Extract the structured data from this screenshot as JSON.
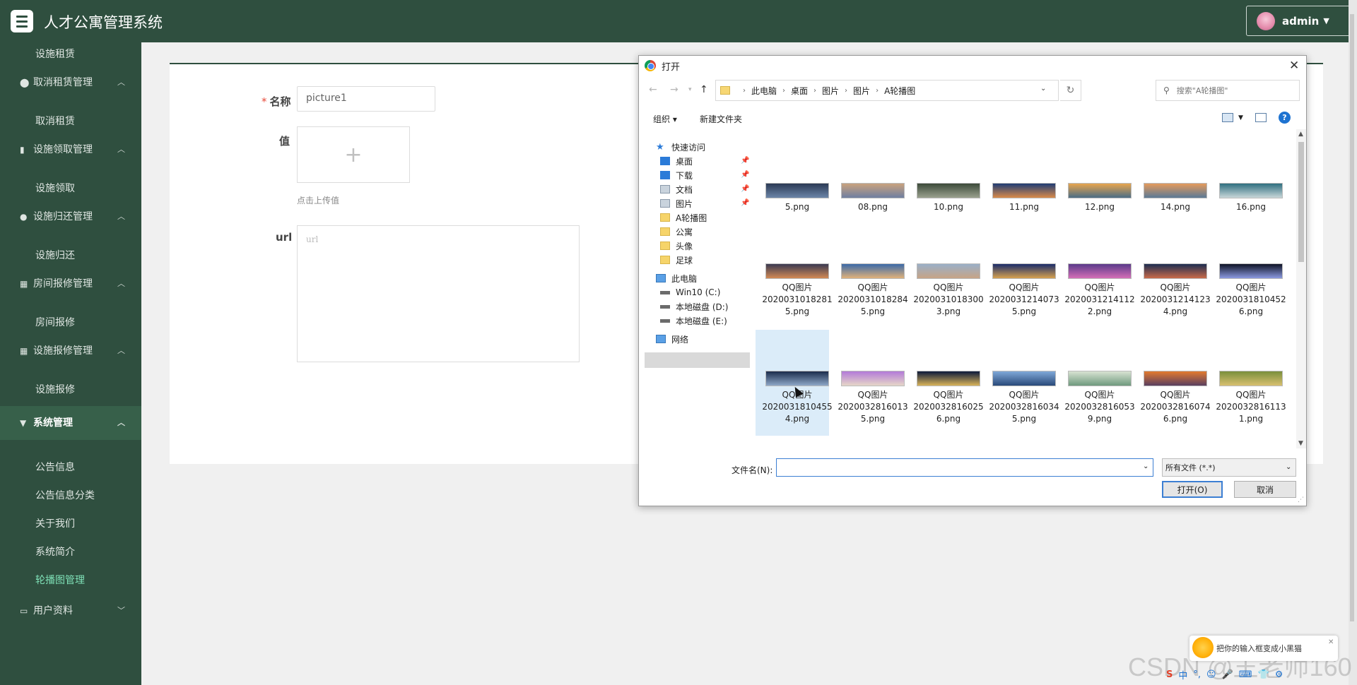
{
  "header": {
    "title": "人才公寓管理系统",
    "user": "admin"
  },
  "sidebar": {
    "items": [
      {
        "type": "sub",
        "label": "设施租赁"
      },
      {
        "type": "group",
        "label": "取消租赁管理",
        "icon": "location-pin-icon"
      },
      {
        "type": "sub",
        "label": "取消租赁"
      },
      {
        "type": "group",
        "label": "设施领取管理",
        "icon": "bar-chart-icon"
      },
      {
        "type": "sub",
        "label": "设施领取"
      },
      {
        "type": "group",
        "label": "设施归还管理",
        "icon": "user-icon"
      },
      {
        "type": "sub",
        "label": "设施归还"
      },
      {
        "type": "group",
        "label": "房间报修管理",
        "icon": "grid-icon"
      },
      {
        "type": "sub",
        "label": "房间报修"
      },
      {
        "type": "group",
        "label": "设施报修管理",
        "icon": "grid-icon"
      },
      {
        "type": "sub",
        "label": "设施报修"
      },
      {
        "type": "group",
        "label": "系统管理",
        "icon": "pin-icon",
        "active": true
      },
      {
        "type": "sub",
        "label": "公告信息"
      },
      {
        "type": "sub",
        "label": "公告信息分类"
      },
      {
        "type": "sub",
        "label": "关于我们"
      },
      {
        "type": "sub",
        "label": "系统简介"
      },
      {
        "type": "sub",
        "label": "轮播图管理",
        "highlight": true
      },
      {
        "type": "group",
        "label": "用户资料",
        "icon": "form-icon"
      }
    ]
  },
  "form": {
    "name_label": "名称",
    "name_value": "picture1",
    "value_label": "值",
    "upload_plus": "+",
    "upload_hint": "点击上传值",
    "url_label": "url",
    "url_placeholder": "url"
  },
  "dialog": {
    "title": "打开",
    "close": "✕",
    "path": [
      "此电脑",
      "桌面",
      "图片",
      "图片",
      "A轮播图"
    ],
    "search_placeholder": "搜索\"A轮播图\"",
    "organize": "组织 ▾",
    "new_folder": "新建文件夹",
    "tree": [
      {
        "label": "快速访问",
        "icon": "star-icon"
      },
      {
        "label": "桌面",
        "icon": "desktop-icon",
        "pinned": true
      },
      {
        "label": "下载",
        "icon": "download-icon",
        "pinned": true
      },
      {
        "label": "文档",
        "icon": "document-icon",
        "pinned": true
      },
      {
        "label": "图片",
        "icon": "pictures-icon",
        "pinned": true
      },
      {
        "label": "A轮播图",
        "icon": "folder-icon"
      },
      {
        "label": "公寓",
        "icon": "folder-icon"
      },
      {
        "label": "头像",
        "icon": "folder-icon"
      },
      {
        "label": "足球",
        "icon": "folder-icon"
      },
      {
        "label": "此电脑",
        "icon": "computer-icon",
        "selected": true
      },
      {
        "label": "Win10 (C:)",
        "icon": "drive-icon"
      },
      {
        "label": "本地磁盘 (D:)",
        "icon": "drive-icon"
      },
      {
        "label": "本地磁盘 (E:)",
        "icon": "drive-icon"
      },
      {
        "label": "网络",
        "icon": "network-icon"
      }
    ],
    "files": [
      {
        "name": "5.png",
        "colors": [
          "#2b3a55",
          "#6d86a8"
        ]
      },
      {
        "name": "08.png",
        "colors": [
          "#c9a27e",
          "#6f7fa0"
        ]
      },
      {
        "name": "10.png",
        "colors": [
          "#3c4a3a",
          "#9aa18e"
        ]
      },
      {
        "name": "11.png",
        "colors": [
          "#1f3c74",
          "#d98b4a"
        ]
      },
      {
        "name": "12.png",
        "colors": [
          "#e8a54d",
          "#4b6d86"
        ]
      },
      {
        "name": "14.png",
        "colors": [
          "#e49a5c",
          "#5b7a96"
        ]
      },
      {
        "name": "16.png",
        "colors": [
          "#2f6f80",
          "#c8d6d8"
        ]
      },
      {
        "name": "QQ图片\n20200310182815.png",
        "colors": [
          "#3a3a52",
          "#d38a54"
        ]
      },
      {
        "name": "QQ图片\n20200310182845.png",
        "colors": [
          "#3b6aa8",
          "#e0b27a"
        ]
      },
      {
        "name": "QQ图片\n20200310183003.png",
        "colors": [
          "#9ab0c8",
          "#c7a486"
        ]
      },
      {
        "name": "QQ图片\n20200312140735.png",
        "colors": [
          "#1a2c6a",
          "#d7a24f"
        ]
      },
      {
        "name": "QQ图片\n20200312141122.png",
        "colors": [
          "#5b3a8a",
          "#d46fb7"
        ]
      },
      {
        "name": "QQ图片\n20200312141234.png",
        "colors": [
          "#1d2d50",
          "#c96b4a"
        ]
      },
      {
        "name": "QQ图片\n20200318104526.png",
        "colors": [
          "#0f1426",
          "#8c9ae0"
        ]
      },
      {
        "name": "QQ图片\n20200318104554.png",
        "colors": [
          "#1b2c4c",
          "#8ea8c8"
        ],
        "selected": true
      },
      {
        "name": "QQ图片\n20200328160135.png",
        "colors": [
          "#b37ad8",
          "#e6d6c8"
        ]
      },
      {
        "name": "QQ图片\n20200328160256.png",
        "colors": [
          "#0d1a3a",
          "#d9b45a"
        ]
      },
      {
        "name": "QQ图片\n20200328160345.png",
        "colors": [
          "#7fa8d8",
          "#2a4a7a"
        ]
      },
      {
        "name": "QQ图片\n20200328160539.png",
        "colors": [
          "#d8e2d2",
          "#6f9a7e"
        ]
      },
      {
        "name": "QQ图片\n20200328160746.png",
        "colors": [
          "#e27a2f",
          "#5a3f60"
        ]
      },
      {
        "name": "QQ图片\n20200328161131.png",
        "colors": [
          "#7a8f3c",
          "#d8c070"
        ]
      }
    ],
    "filename_label": "文件名(N):",
    "filename_value": "",
    "filetype": "所有文件 (*.*)",
    "open_button": "打开(O)",
    "cancel_button": "取消"
  },
  "ime": {
    "tip": "把你的输入框变成小黑猫",
    "bar": [
      "S",
      "中",
      "°,",
      "☺",
      "🎤",
      "⌨",
      "👕",
      "⚙"
    ]
  },
  "watermark": "CSDN @王老师160"
}
